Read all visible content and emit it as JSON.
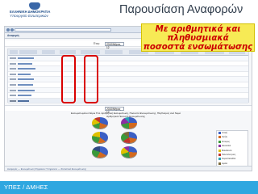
{
  "header": {
    "logo": {
      "line1": "ΕΛΛΗΝΙΚΗ ΔΗΜΟΚΡΑΤΙΑ",
      "line2": "Υπουργείο Εσωτερικών",
      "colors": {
        "crest": "#3a67a8",
        "text": "#1f4e8a"
      }
    },
    "title": "Παρουσίαση Αναφορών"
  },
  "callout": {
    "lines": [
      "Με αριθμητικά και",
      "πληθυσμιακά",
      "ποσοστά ενσωμάτωσης"
    ],
    "colors": {
      "background": "#f7ea55",
      "text": "#cc0000"
    }
  },
  "screenshot": {
    "period_label": "Έτος:",
    "period_value": "2010/Μήνας 12",
    "report_tab": "Αναφορές",
    "second_period_value": "2010/Μήνας 12",
    "chart_title_line1": "Ενσωματωμένοι Νόμοι Π.Δ. Αριθμητική Ενσωμάτωση, Ποσοστό Ενσωμάτωσης, Πληθυσμός ανά Νομό",
    "chart_title_line2": "Αριθμητικό Ποσοστό Ενσωμάτωσης",
    "status_text": "Αναφορές — Ενσωμάτωση Ψηφιακών Υπηρεσιών — Στατιστικά Ενσωμάτωσης"
  },
  "legend": {
    "items": [
      {
        "label": "Αττική",
        "color": "#3b5fc4"
      },
      {
        "label": "Κρήτη",
        "color": "#d2691e"
      },
      {
        "label": "Ήπειρος",
        "color": "#3a9a3a"
      },
      {
        "label": "Θεσσαλία",
        "color": "#8b2fa3"
      },
      {
        "label": "Μακεδονία",
        "color": "#e0c000"
      },
      {
        "label": "Πελοπόννησος",
        "color": "#c2362c"
      },
      {
        "label": "Στερεά Ελλάδα",
        "color": "#2aa4b8"
      },
      {
        "label": "Αιγαίο",
        "color": "#7b6a3a"
      },
      {
        "label": "Θράκη",
        "color": "#2f4a82"
      }
    ]
  },
  "footer": {
    "text": "ΥΠΕΣ / ΔΜΗΕΣ",
    "color": "#2fa7e0"
  }
}
